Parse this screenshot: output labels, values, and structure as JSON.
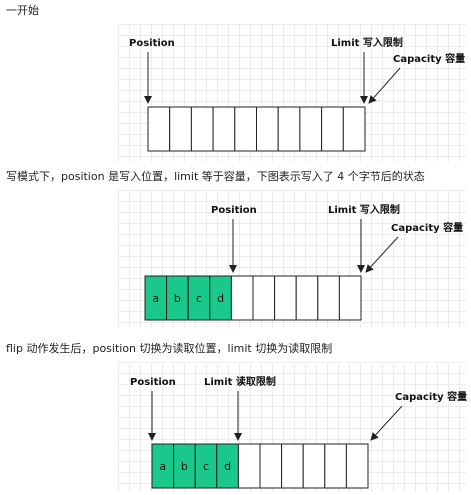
{
  "captions": {
    "start": "一开始",
    "write_mode": "写模式下，position 是写入位置，limit 等于容量，下图表示写入了 4 个字节后的状态",
    "after_flip": "flip 动作发生后，position 切换为读取位置，limit 切换为读取限制"
  },
  "diagrams": [
    {
      "position_label": "Position",
      "limit_label": "Limit 写入限制",
      "capacity_label": "Capacity 容量",
      "cells": [
        "",
        "",
        "",
        "",
        "",
        "",
        "",
        "",
        "",
        ""
      ]
    },
    {
      "position_label": "Position",
      "limit_label": "Limit 写入限制",
      "capacity_label": "Capacity 容量",
      "cells": [
        "a",
        "b",
        "c",
        "d",
        "",
        "",
        "",
        "",
        "",
        ""
      ]
    },
    {
      "position_label": "Position",
      "limit_label": "Limit 读取限制",
      "capacity_label": "Capacity 容量",
      "cells": [
        "a",
        "b",
        "c",
        "d",
        "",
        "",
        "",
        "",
        "",
        ""
      ]
    }
  ],
  "colors": {
    "filled_cell": "#19c88a",
    "empty_cell": "#ffffff",
    "stroke": "#222222",
    "grid": "#ececec"
  }
}
